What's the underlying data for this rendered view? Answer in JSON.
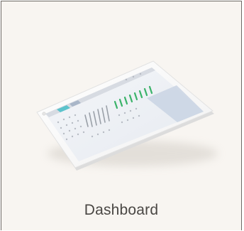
{
  "card": {
    "label": "Dashboard",
    "illustration_icon": "tablet-dashboard-icon",
    "colors": {
      "background": "#f8f5f1",
      "border": "#6e6a66",
      "label": "#4a4744",
      "tablet_frame": "#ffffff",
      "screen": "#eef0f4",
      "accent_green": "#3bb36a",
      "accent_teal": "#5cc3cc",
      "sidebar_blue": "#c9d3e3"
    }
  }
}
